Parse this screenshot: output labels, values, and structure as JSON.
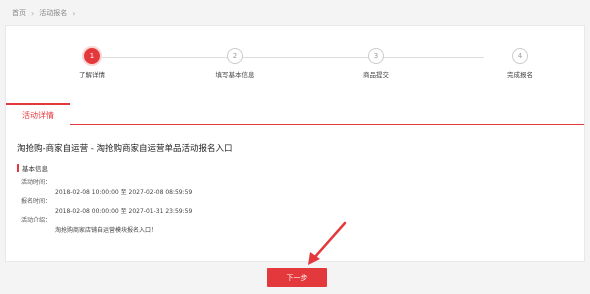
{
  "breadcrumb": {
    "home": "首页",
    "current": "活动报名"
  },
  "steps": [
    {
      "num": "1",
      "label": "了解详情"
    },
    {
      "num": "2",
      "label": "填写基本信息"
    },
    {
      "num": "3",
      "label": "商品提交"
    },
    {
      "num": "4",
      "label": "完成报名"
    }
  ],
  "tabs": {
    "active": "活动详情"
  },
  "activity": {
    "title": "淘抢购-商家自运营 - 淘抢购商家自运营单品活动报名入口",
    "section_label": "基本信息",
    "activity_time_label": "活动时间：",
    "activity_time_value": "2018-02-08 10:00:00 至 2027-02-08 08:59:59",
    "signup_time_label": "报名时间：",
    "signup_time_value": "2018-02-08 00:00:00 至 2027-01-31 23:59:59",
    "intro_label": "活动介绍：",
    "intro_value": "淘抢购商家店铺自运营模块报名入口！"
  },
  "buttons": {
    "next": "下一步"
  },
  "colors": {
    "accent": "#e4393c"
  }
}
